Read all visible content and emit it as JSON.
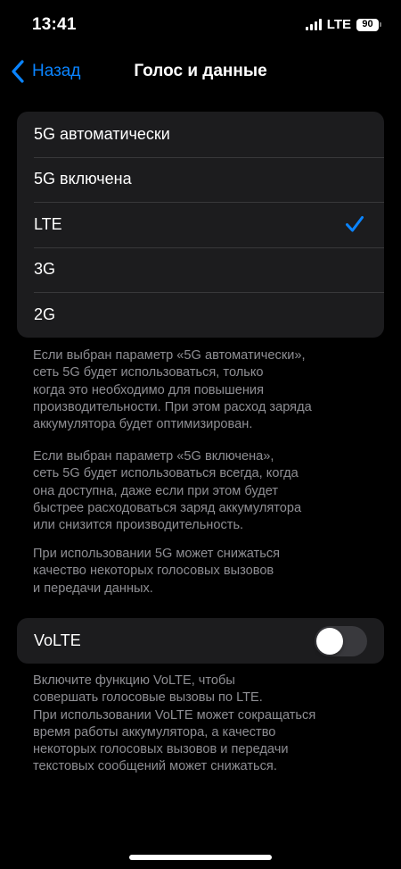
{
  "status_bar": {
    "time": "13:41",
    "network": "LTE",
    "battery": "90"
  },
  "nav": {
    "back_label": "Назад",
    "title": "Голос и данные"
  },
  "options": {
    "items": [
      {
        "label": "5G автоматически",
        "selected": false
      },
      {
        "label": "5G включена",
        "selected": false
      },
      {
        "label": "LTE",
        "selected": true
      },
      {
        "label": "3G",
        "selected": false
      },
      {
        "label": "2G",
        "selected": false
      }
    ]
  },
  "footnotes": {
    "auto": "Если выбран параметр «5G автоматически»,\nсеть 5G будет использоваться, только\nкогда это необходимо для повышения\nпроизводительности. При этом расход заряда\nаккумулятора будет оптимизирован.",
    "on": "Если выбран параметр «5G включена»,\nсеть 5G будет использоваться всегда, когда\nона доступна, даже если при этом будет\nбыстрее расходоваться заряд аккумулятора\nили снизится производительность.",
    "quality": "При использовании 5G может снижаться\nкачество некоторых голосовых вызовов\nи передачи данных.",
    "volte": "Включите функцию VoLTE, чтобы\nсовершать голосовые вызовы по LTE.\nПри использовании VoLTE может сокращаться\nвремя работы аккумулятора, а качество\nнекоторых голосовых вызовов и передачи\nтекстовых сообщений может снижаться."
  },
  "volte": {
    "label": "VoLTE",
    "enabled": false
  },
  "colors": {
    "accent": "#0a84ff",
    "cell_background": "#1c1c1e",
    "secondary_text": "#8e8e93",
    "toggle_off": "#39393d"
  }
}
